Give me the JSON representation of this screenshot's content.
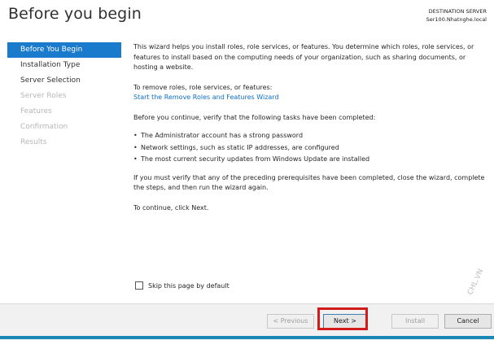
{
  "header": {
    "title": "Before you begin",
    "destination_label": "DESTINATION SERVER",
    "destination_server": "Ser100.Nhatnghe.local"
  },
  "sidebar": {
    "items": [
      {
        "label": "Before You Begin",
        "state": "active"
      },
      {
        "label": "Installation Type",
        "state": "enabled"
      },
      {
        "label": "Server Selection",
        "state": "enabled"
      },
      {
        "label": "Server Roles",
        "state": "disabled"
      },
      {
        "label": "Features",
        "state": "disabled"
      },
      {
        "label": "Confirmation",
        "state": "disabled"
      },
      {
        "label": "Results",
        "state": "disabled"
      }
    ]
  },
  "content": {
    "intro": "This wizard helps you install roles, role services, or features. You determine which roles, role services, or features to install based on the computing needs of your organization, such as sharing documents, or hosting a website.",
    "remove_label": "To remove roles, role services, or features:",
    "remove_link": "Start the Remove Roles and Features Wizard",
    "verify_text": "Before you continue, verify that the following tasks have been completed:",
    "bullets": [
      "The Administrator account has a strong password",
      "Network settings, such as static IP addresses, are configured",
      "The most current security updates from Windows Update are installed"
    ],
    "prereq_text": "If you must verify that any of the preceding prerequisites have been completed, close the wizard, complete the steps, and then run the wizard again.",
    "continue_text": "To continue, click Next."
  },
  "skip_checkbox": {
    "label": "Skip this page by default",
    "checked": false
  },
  "buttons": {
    "previous": "< Previous",
    "next": "Next >",
    "install": "Install",
    "cancel": "Cancel"
  },
  "watermark": "CHL.VN",
  "colors": {
    "accent": "#1a7acb",
    "link": "#0f6fc6",
    "highlight": "#d31b1b"
  }
}
